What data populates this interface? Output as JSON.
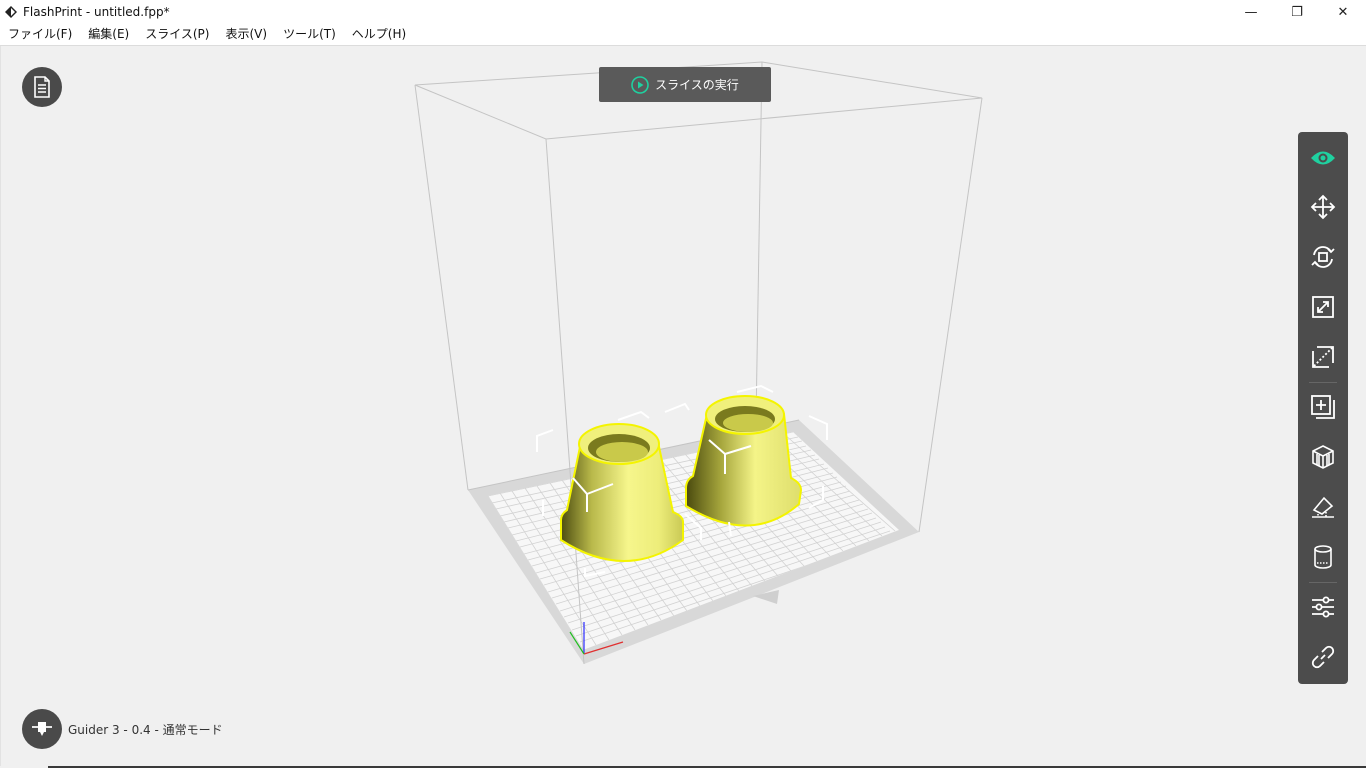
{
  "window": {
    "title": "FlashPrint - untitled.fpp*",
    "minimize_glyph": "—",
    "maximize_glyph": "❐",
    "close_glyph": "✕"
  },
  "menu": [
    {
      "label": "ファイル(F)"
    },
    {
      "label": "編集(E)"
    },
    {
      "label": "スライス(P)"
    },
    {
      "label": "表示(V)"
    },
    {
      "label": "ツール(T)"
    },
    {
      "label": "ヘルプ(H)"
    }
  ],
  "viewport": {
    "slice_button_label": "スライスの実行",
    "machine_status": "Guider 3 - 0.4 - 通常モード"
  },
  "toolbar": {
    "tools": [
      {
        "name": "view-icon",
        "active": true
      },
      {
        "name": "move-icon"
      },
      {
        "name": "rotate-icon"
      },
      {
        "name": "scale-icon"
      },
      {
        "name": "cut-icon"
      },
      {
        "name": "add-copy-icon"
      },
      {
        "name": "supports-icon"
      },
      {
        "name": "lay-flat-icon"
      },
      {
        "name": "raft-icon"
      },
      {
        "name": "settings-sliders-icon"
      },
      {
        "name": "link-icon"
      }
    ]
  },
  "colors": {
    "accent": "#1fd1a0",
    "model": "#f2f27a",
    "toolbar_bg": "#4c4c4c",
    "button_bg": "#5a5a5a",
    "viewport_bg": "#f0f0f0"
  }
}
